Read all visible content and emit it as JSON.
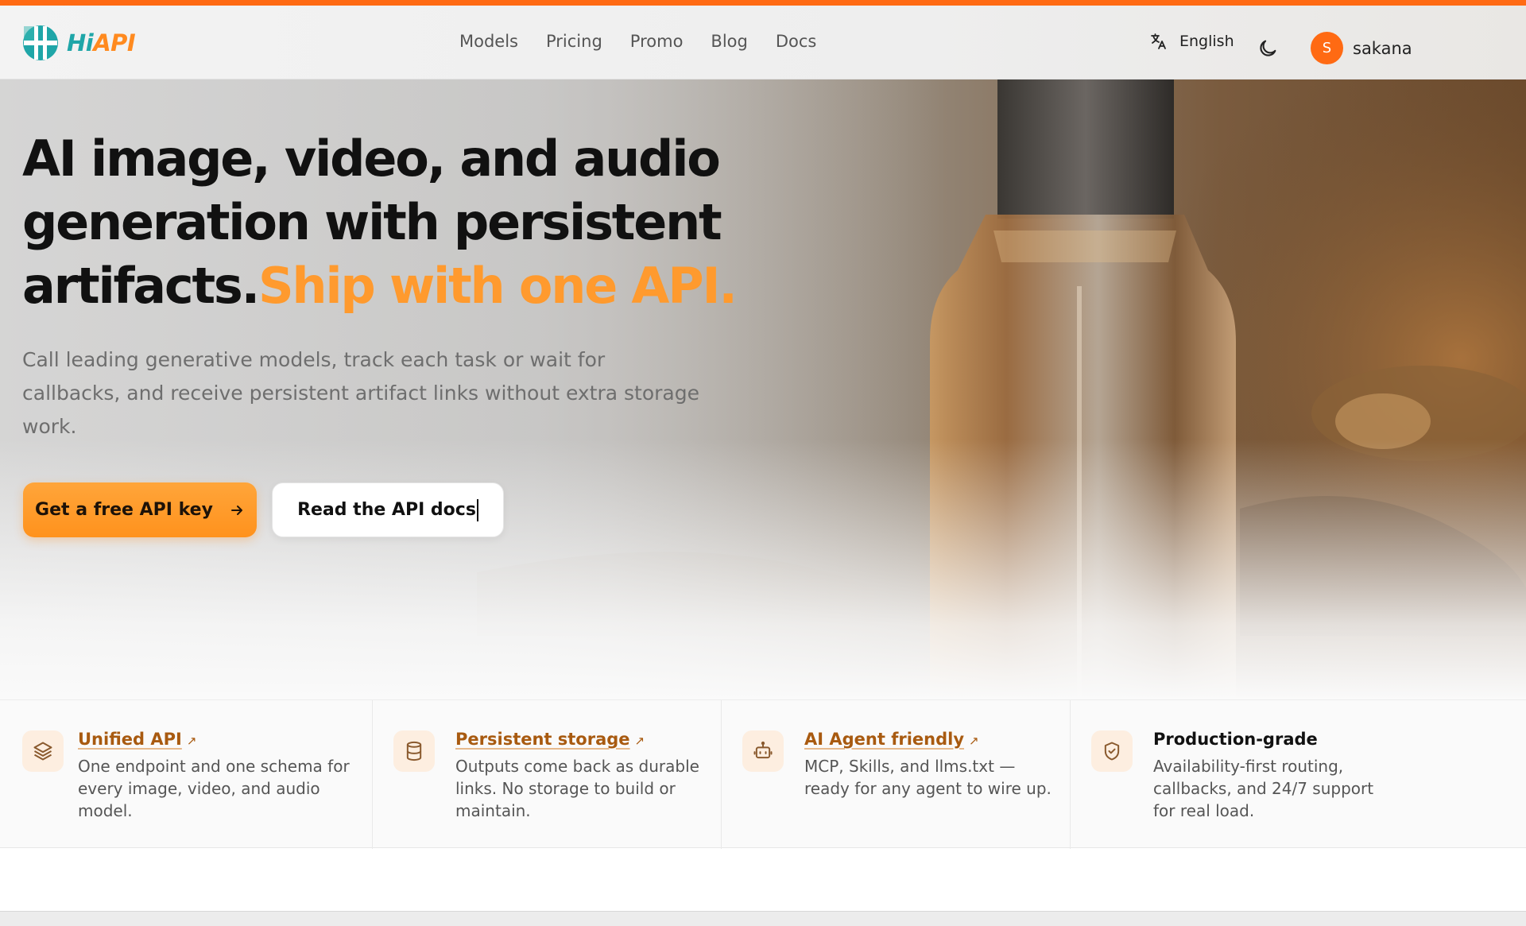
{
  "header": {
    "logo_text_a": "Hi",
    "logo_text_b": "API",
    "nav": [
      "Models",
      "Pricing",
      "Promo",
      "Blog",
      "Docs"
    ],
    "language": "English",
    "user": {
      "initial": "S",
      "name": "sakana"
    }
  },
  "hero": {
    "title_line1": "AI image, video, and audio",
    "title_line2": "generation with persistent",
    "title_line3": "artifacts.",
    "title_highlight": "Ship with one API.",
    "subtitle_line1": "Call leading generative models, track each task or wait for",
    "subtitle_line2": "callbacks, and receive persistent artifact links without extra storage",
    "subtitle_line3": "work.",
    "primary_cta": "Get a free API key",
    "secondary_cta": "Read the API docs"
  },
  "features": [
    {
      "title": "Unified API",
      "desc": [
        "One endpoint and one schema for",
        "every image, video, and audio",
        "model."
      ],
      "icon": "layers-icon",
      "link": true
    },
    {
      "title": "Persistent storage",
      "desc": [
        "Outputs come back as durable",
        "links. No storage to build or",
        "maintain."
      ],
      "icon": "database-icon",
      "link": true
    },
    {
      "title": "AI Agent friendly",
      "desc": [
        "MCP, Skills, and llms.txt —",
        "ready for any agent to wire up."
      ],
      "icon": "robot-icon",
      "link": true
    },
    {
      "title": "Production-grade",
      "desc": [
        "Availability-first routing,",
        "callbacks, and 24/7 support",
        "for real load."
      ],
      "icon": "shield-check-icon",
      "link": false
    }
  ],
  "colors": {
    "accent": "#ff6a13",
    "cta": "#ff9a2e",
    "link": "#a85a10",
    "teal": "#1fa6a8"
  }
}
